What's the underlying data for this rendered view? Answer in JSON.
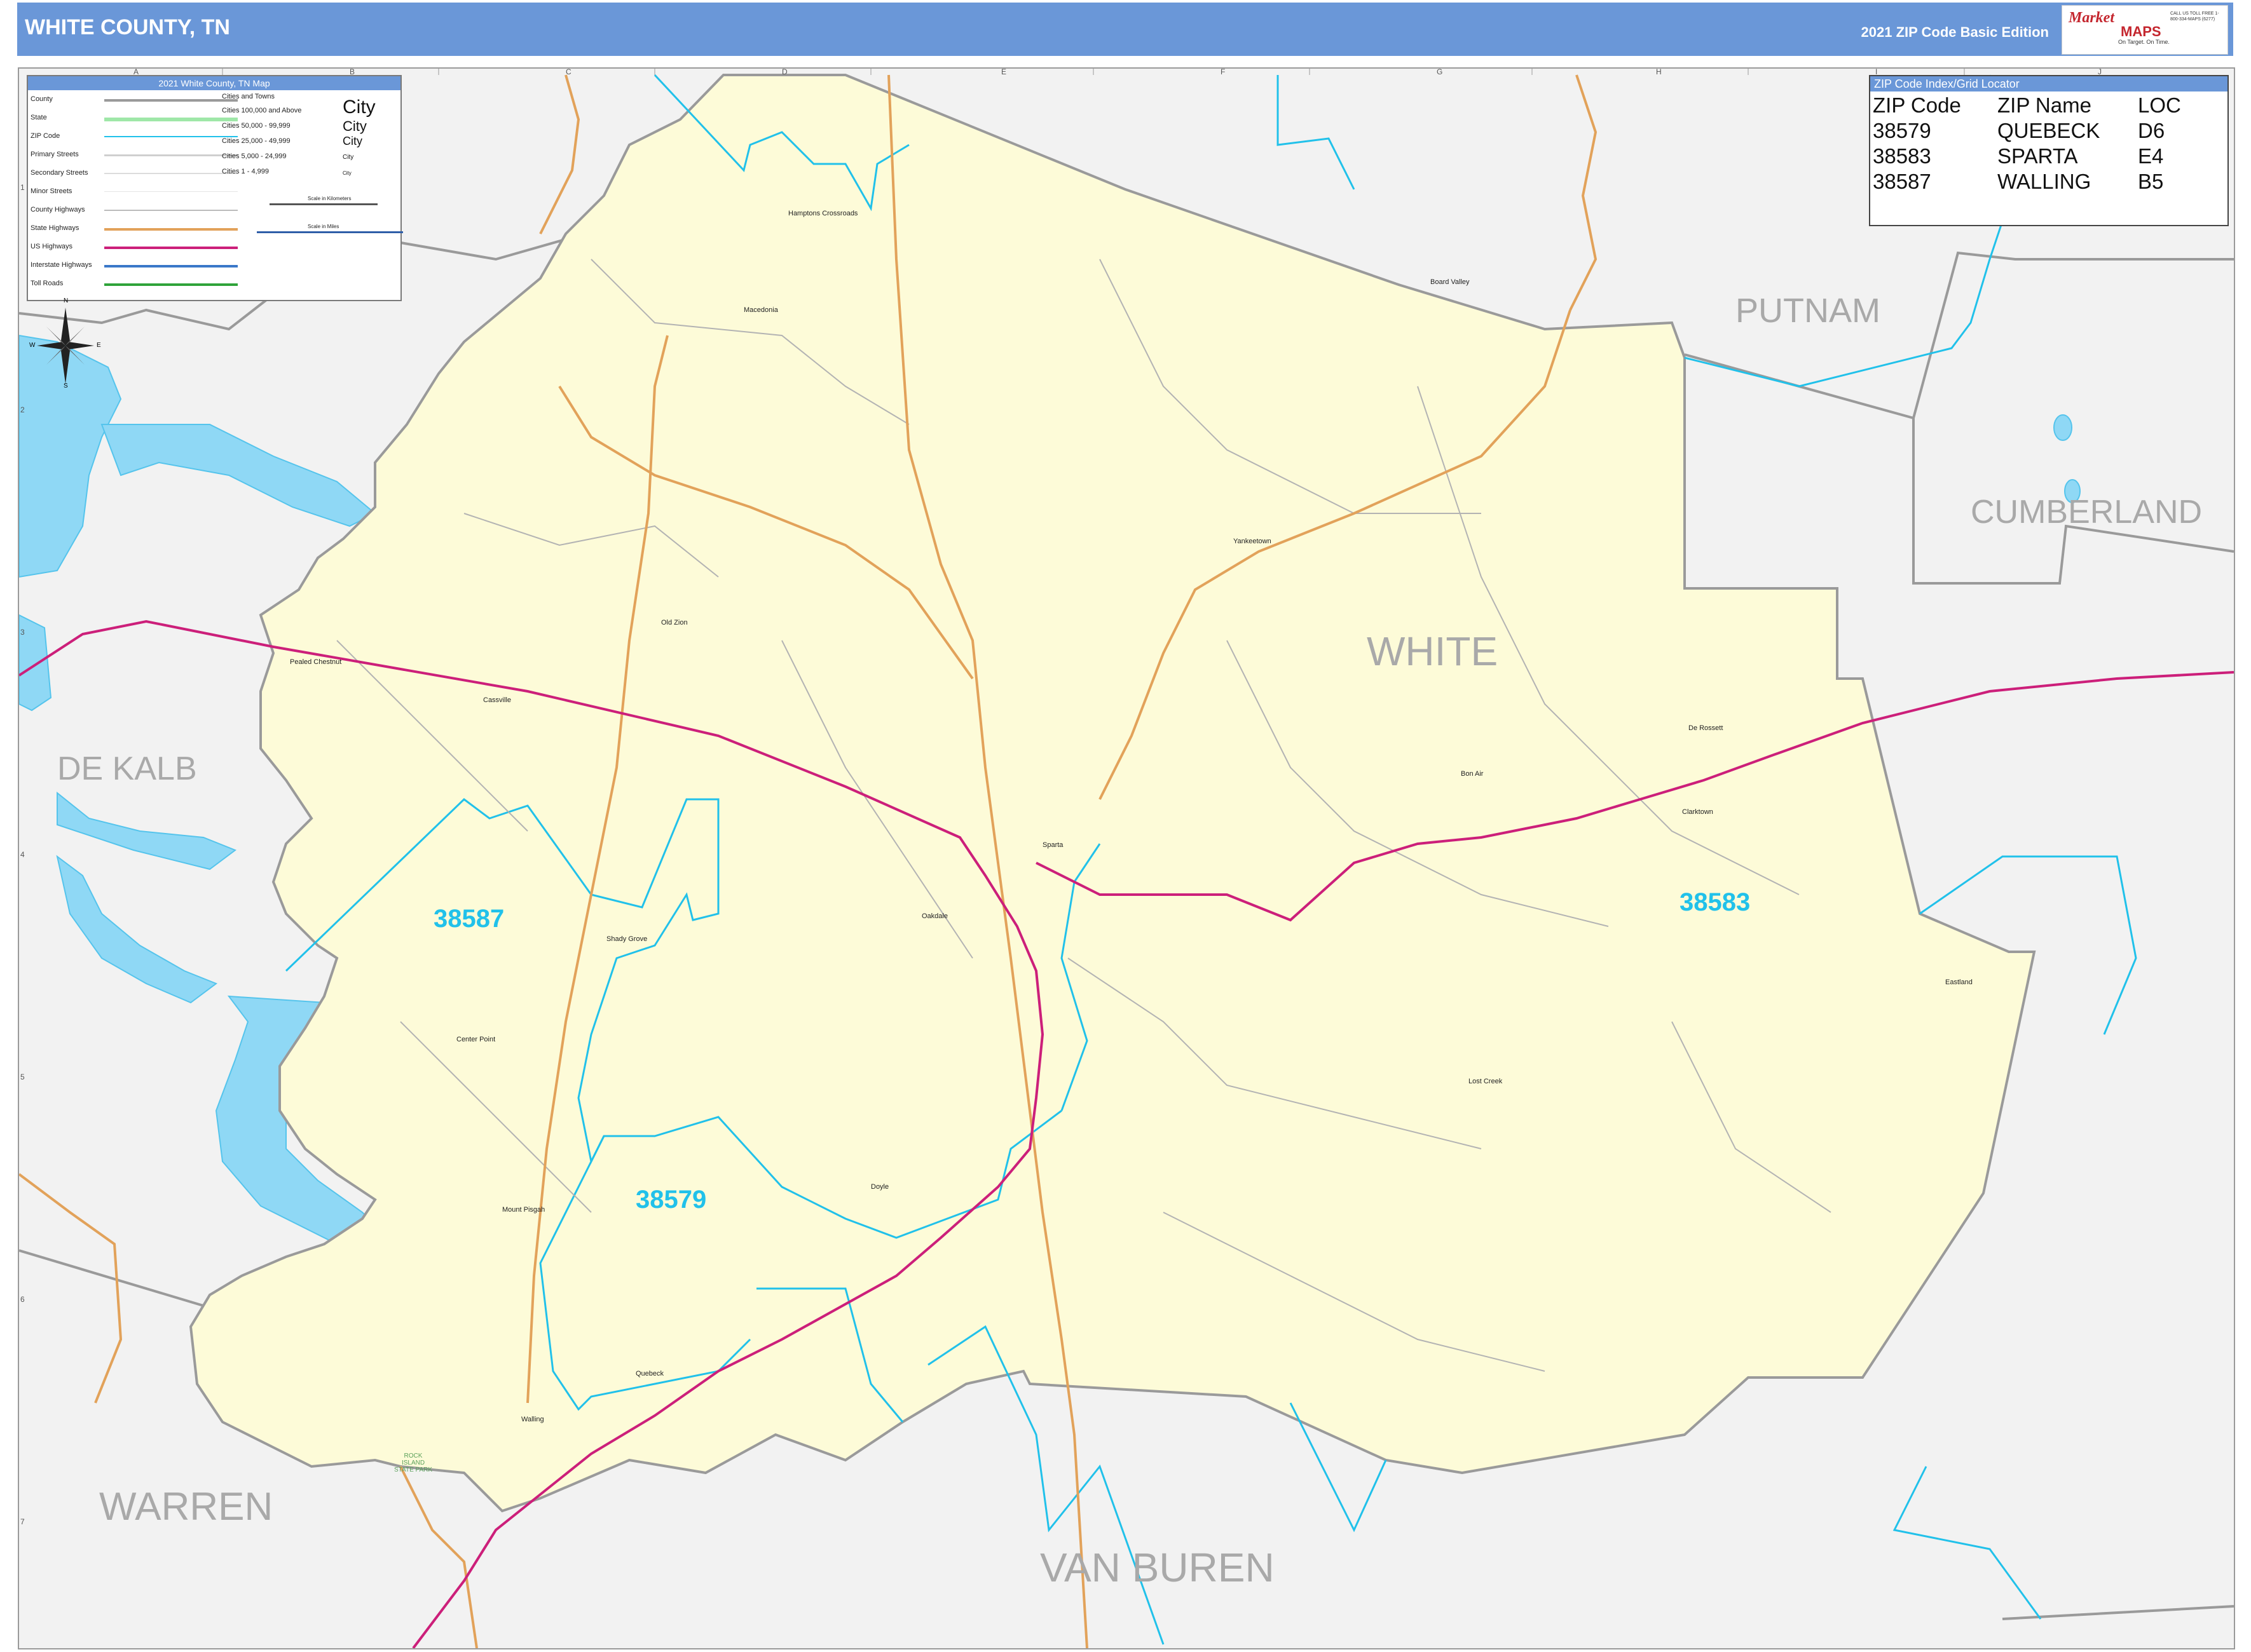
{
  "header": {
    "title": "WHITE COUNTY, TN",
    "edition": "2021 ZIP Code Basic Edition",
    "logo_main": "Market",
    "logo_sub": "MAPS",
    "logo_tagline": "On Target. On Time.",
    "logo_contact": "CALL US TOLL FREE 1-800-334-MAPS (6277)"
  },
  "colors": {
    "county_fill": "#fdfbd8",
    "background": "#f2f2f2",
    "water": "#8fd8f5",
    "zip_border": "#21c1ea",
    "us_highway": "#cc1f7a",
    "state_highway": "#e2a25a",
    "county_border": "#9a9a9a",
    "header": "#6a97d8"
  },
  "legend": {
    "title": "2021 White County, TN Map",
    "items": [
      "County",
      "State",
      "ZIP Code",
      "Primary Streets",
      "Secondary Streets",
      "Minor Streets",
      "County Highways",
      "State Highways",
      "US Highways",
      "Interstate Highways",
      "Toll Roads"
    ],
    "cities_header": "Cities and Towns",
    "cities": [
      "Cities 100,000 and Above",
      "Cities 50,000 - 99,999",
      "Cities 25,000 - 49,999",
      "Cities 5,000 - 24,999",
      "Cities 1 - 4,999"
    ],
    "city_sample": "City",
    "scale_km": "Scale in Kilometers",
    "scale_mi": "Scale in Miles"
  },
  "compass": {
    "n": "N",
    "s": "S",
    "e": "E",
    "w": "W"
  },
  "zip_index": {
    "title": "ZIP Code Index/Grid Locator",
    "headers": [
      "ZIP Code",
      "ZIP Name",
      "LOC"
    ],
    "rows": [
      [
        "38579",
        "QUEBECK",
        "D6"
      ],
      [
        "38583",
        "SPARTA",
        "E4"
      ],
      [
        "38587",
        "WALLING",
        "B5"
      ]
    ]
  },
  "counties": {
    "white": "WHITE",
    "putnam": "PUTNAM",
    "cumberland": "CUMBERLAND",
    "dekalb": "DE KALB",
    "warren": "WARREN",
    "vanburen": "VAN BUREN"
  },
  "zips": {
    "z38587": "38587",
    "z38583": "38583",
    "z38579": "38579"
  },
  "towns": {
    "hamptons": "Hamptons Crossroads",
    "macedonia": "Macedonia",
    "boardvalley": "Board Valley",
    "yankeetown": "Yankeetown",
    "oldzion": "Old Zion",
    "pealed": "Pealed Chestnut",
    "cassville": "Cassville",
    "sparta": "Sparta",
    "bonair": "Bon Air",
    "derossett": "De Rossett",
    "clarktown": "Clarktown",
    "eastland": "Eastland",
    "lostcreek": "Lost Creek",
    "oakdale": "Oakdale",
    "shadygrove": "Shady Grove",
    "centerpoint": "Center Point",
    "mountpisgah": "Mount Pisgah",
    "doyle": "Doyle",
    "quebeck": "Quebeck",
    "walling": "Walling",
    "rockisland": "ROCK ISLAND STATE PARK"
  },
  "grid": {
    "cols": [
      "A",
      "B",
      "C",
      "D",
      "E",
      "F",
      "G",
      "H",
      "I",
      "J"
    ],
    "rows": [
      "1",
      "2",
      "3",
      "4",
      "5",
      "6",
      "7"
    ]
  }
}
